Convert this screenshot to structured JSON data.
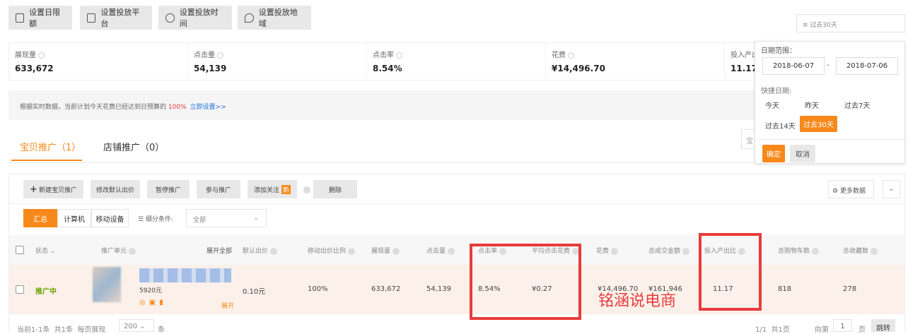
{
  "toolbar": [
    "设置日限额",
    "设置投放平台",
    "设置投放时间",
    "设置投放地域"
  ],
  "date_trigger": "过去30天",
  "stats": [
    {
      "label": "展现量",
      "value": "633,672"
    },
    {
      "label": "点击量",
      "value": "54,139"
    },
    {
      "label": "点击率",
      "value": "8.54%"
    },
    {
      "label": "花费",
      "value": "¥14,496.70"
    },
    {
      "label": "投入产出",
      "value": "11.17"
    }
  ],
  "notice": {
    "text": "根据实时数据，当前计划今天花费已经达到日预算的",
    "percent": "100%",
    "link": "立即设置>>"
  },
  "tabs": [
    {
      "label": "宝贝推广（1）"
    },
    {
      "label": "店铺推广（0）"
    }
  ],
  "search_partial": "宝",
  "date_popup": {
    "range_label": "日期范围：",
    "start": "2018-06-07",
    "sep": "-",
    "end": "2018-07-06",
    "quick_label": "快捷日期:",
    "quick": [
      "今天",
      "昨天",
      "过去7天",
      "过去14天",
      "过去30天"
    ],
    "ok": "确定",
    "cancel": "取消"
  },
  "actions": {
    "new": "新建宝贝推广",
    "edit_bid": "修改默认出价",
    "pause": "暂停推广",
    "join": "参与推广",
    "follow": "添加关注",
    "new_badge": "新",
    "delete": "删除",
    "more_data": "更多数据"
  },
  "filters": {
    "segments": [
      "汇总",
      "计算机",
      "移动设备"
    ],
    "condition_label": "细分条件:",
    "condition_value": "全部"
  },
  "table": {
    "headers": {
      "status": "状态",
      "unit": "推广单元",
      "expand_all": "展开全部",
      "bid": "默认出价",
      "mobile_ratio": "移动出价比例",
      "impressions": "展现量",
      "clicks": "点击量",
      "ctr": "点击率",
      "cpc": "平均点击花费",
      "cost": "花费",
      "gmv": "总成交金额",
      "roi": "投入产出比",
      "carts": "总购物车数",
      "favs": "总收藏数"
    },
    "row": {
      "status": "推广中",
      "price": "5920元",
      "expand": "展开",
      "bid": "0.10元",
      "mobile_ratio": "100%",
      "impressions": "633,672",
      "clicks": "54,139",
      "ctr": "8.54%",
      "cpc": "¥0.27",
      "cost": "¥14,496.70",
      "gmv": "¥161,946",
      "roi": "11.17",
      "carts": "818",
      "favs": "278"
    }
  },
  "footer": {
    "range": "当前1-1条",
    "total": "共1条",
    "per_page_label": "每页展现",
    "per_page": "200",
    "unit": "条",
    "pages": "1/1",
    "total_pages": "共1页",
    "goto_label": "向第",
    "goto_value": "1",
    "page_unit": "页",
    "jump": "跳转"
  },
  "watermark": "铭涵说电商",
  "colors": {
    "accent": "#f7891a",
    "annotation": "#e93b3b",
    "status_green": "#6aa000"
  }
}
